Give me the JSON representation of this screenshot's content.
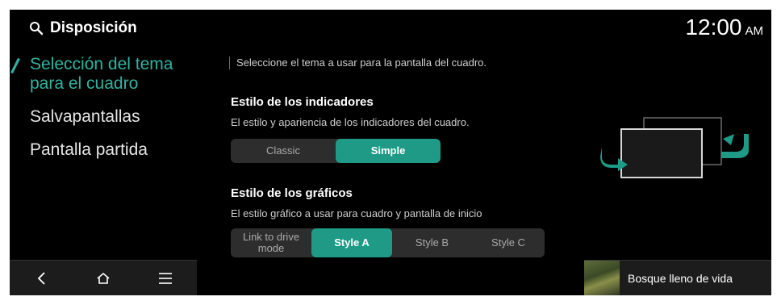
{
  "header": {
    "title": "Disposición",
    "time": "12:00",
    "ampm": "AM"
  },
  "sidebar": {
    "items": [
      {
        "label_line1": "Selección del tema",
        "label_line2": "para el cuadro",
        "active": true
      },
      {
        "label": "Salvapantallas"
      },
      {
        "label": "Pantalla partida"
      }
    ]
  },
  "main": {
    "intro": "Seleccione el tema a usar para la pantalla del cuadro.",
    "indicators": {
      "title": "Estilo de los indicadores",
      "description": "El estilo y apariencia de los indicadores del cuadro.",
      "options": [
        "Classic",
        "Simple"
      ],
      "selected": "Simple"
    },
    "graphics": {
      "title": "Estilo de los gráficos",
      "description": "El estilo gráfico a usar para cuadro y pantalla de inicio",
      "options": [
        "Link to drive mode",
        "Style A",
        "Style B",
        "Style C"
      ],
      "selected": "Style A"
    }
  },
  "nav": {
    "icons": [
      "back-icon",
      "home-icon",
      "menu-icon"
    ]
  },
  "media": {
    "title": "Bosque lleno de vida"
  },
  "colors": {
    "accent": "#1e9a86",
    "accent_text": "#2fb3a0",
    "background": "#000000"
  }
}
